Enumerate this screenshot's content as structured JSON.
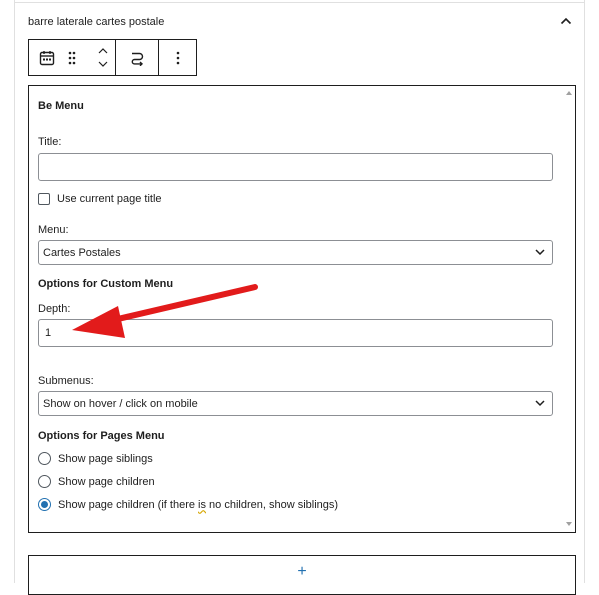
{
  "panel": {
    "title": "barre laterale cartes postale"
  },
  "widget": {
    "title": "Be Menu",
    "title_label": "Title:",
    "title_value": "",
    "use_current_page_title_label": "Use current page title",
    "use_current_page_title_checked": false,
    "menu_label": "Menu:",
    "menu_selected": "Cartes Postales",
    "custom_menu_heading": "Options for Custom Menu",
    "depth_label": "Depth:",
    "depth_value": "1",
    "submenus_label": "Submenus:",
    "submenus_selected": "Show on hover / click on mobile",
    "pages_menu_heading": "Options for Pages Menu",
    "radio_options": [
      {
        "label": "Show page siblings",
        "selected": false
      },
      {
        "label": "Show page children",
        "selected": false
      },
      {
        "label_pre": "Show page children (if there ",
        "label_mark": "is",
        "label_post": " no children, show siblings)",
        "selected": true
      }
    ]
  },
  "add_block": {
    "symbol": "+"
  },
  "colors": {
    "accent": "#2271b1",
    "annotation_arrow": "#e21b1b",
    "border_dark": "#1e1e1e",
    "input_border": "#8c8f94"
  },
  "icons": {
    "panel_toggle": "chevron-up-icon",
    "block_type": "calendar-icon",
    "drag": "drag-handle-icon",
    "move_up": "chevron-up-icon",
    "move_down": "chevron-down-icon",
    "transform": "loop-icon",
    "options": "more-vertical-icon",
    "select_chevron": "chevron-down-icon",
    "add": "plus-icon"
  }
}
